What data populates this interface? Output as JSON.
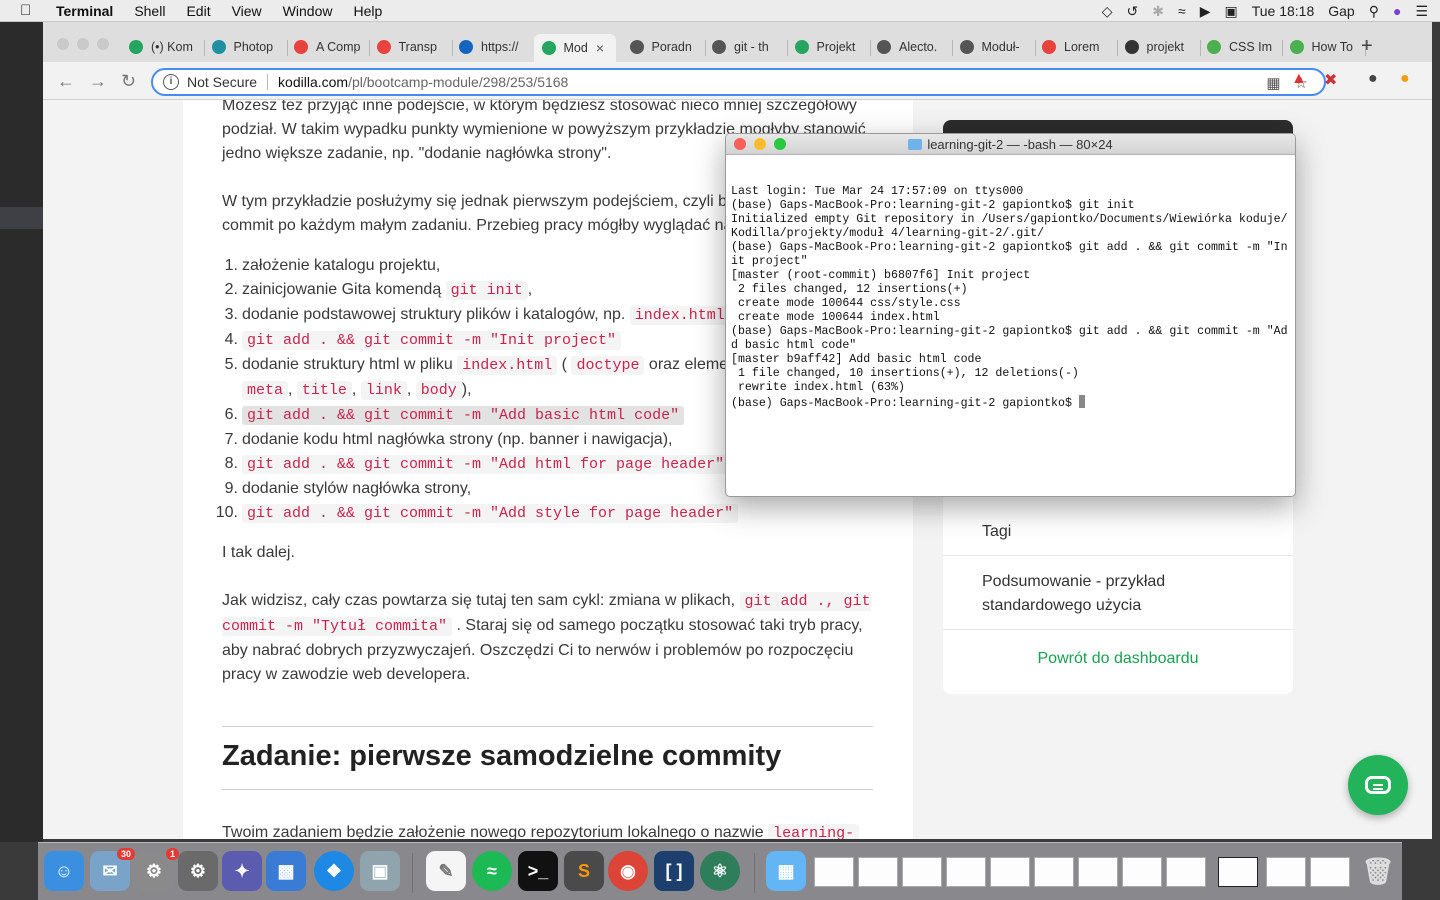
{
  "menubar": {
    "app": "Terminal",
    "items": [
      "Shell",
      "Edit",
      "View",
      "Window",
      "Help"
    ],
    "clock": "Tue 18:18",
    "user": "Gap"
  },
  "browser": {
    "tabs": [
      {
        "label": "(•) Kom",
        "color": "#25a55f"
      },
      {
        "label": "Photop",
        "color": "#1e90a0"
      },
      {
        "label": "A Comp",
        "color": "#e8433c"
      },
      {
        "label": "Transp",
        "color": "#e8433c"
      },
      {
        "label": "https://",
        "color": "#1565c0"
      },
      {
        "label": "Mod",
        "color": "#25a55f"
      },
      {
        "label": "Poradn",
        "color": "#555555"
      },
      {
        "label": "git - th",
        "color": "#555555"
      },
      {
        "label": "Projekt",
        "color": "#25a55f"
      },
      {
        "label": "Alecto.",
        "color": "#555555"
      },
      {
        "label": "Moduł-",
        "color": "#555555"
      },
      {
        "label": "Lorem",
        "color": "#e8433c"
      },
      {
        "label": "projekt",
        "color": "#333333"
      },
      {
        "label": "CSS Im",
        "color": "#4caf50"
      },
      {
        "label": "How To",
        "color": "#4caf50"
      }
    ],
    "url_security": "Not Secure",
    "url_host": "kodilla.com",
    "url_path": "/pl/bootcamp-module/298/253/5168"
  },
  "article": {
    "para1": "Możesz też przyjąć inne podejście, w którym będziesz stosować nieco mniej szczegółowy podział. W takim wypadku punkty wymienione w powyższym przykładzie mogłyby stanowić jedno większe zadanie, np. \"dodanie nagłówka strony\".",
    "para2": "W tym przykładzie posłużymy się jednak pierwszym podejściem, czyli będziemy robić commit po każdym małym zadaniu. Przebieg pracy mógłby wyglądać następująco:",
    "steps": {
      "s1": "założenie katalogu projektu,",
      "s2_text": "zainicjowanie Gita komendą",
      "s2_code": "git init",
      "s3_text": "dodanie podstawowej struktury plików i katalogów, np.",
      "s3_code": "index.html",
      "s4_code": "git add . && git commit -m \"Init project\"",
      "s5_text": "dodanie struktury html w pliku",
      "s5_code1": "index.html",
      "s5_code2": "doctype",
      "s5_tail": "oraz elementów",
      "s5_c3": "meta",
      "s5_c4": "title",
      "s5_c5": "link",
      "s5_c6": "body",
      "s6_code": "git add . && git commit -m \"Add basic html code\"",
      "s7": "dodanie kodu html nagłówka strony (np. banner i nawigacja),",
      "s8_code": "git add . && git commit -m \"Add html for page header\"",
      "s9": "dodanie stylów nagłówka strony,",
      "s10_code": "git add . && git commit -m \"Add style for page header\""
    },
    "tak_dalej": "I tak dalej.",
    "para3_a": "Jak widzisz, cały czas powtarza się tutaj ten sam cykl: zmiana w plikach,",
    "para3_code": "git add ., git commit -m \"Tytuł commita\"",
    "para3_b": ". Staraj się od samego początku stosować taki tryb pracy, aby nabrać dobrych przyzwyczajeń. Oszczędzi Ci to nerwów i problemów po rozpoczęciu pracy w zawodzie web developera.",
    "heading": "Zadanie: pierwsze samodzielne commity",
    "para4": "Twoim zadaniem będzie założenie nowego repozytorium lokalnego o nazwie",
    "para4_code": "learning-"
  },
  "sidebar": {
    "item_tagi": "Tagi",
    "item_summary": "Podsumowanie - przykład standardowego użycia",
    "back": "Powrót do dashboardu"
  },
  "terminal": {
    "title": "learning-git-2 — -bash — 80×24",
    "lines": [
      "Last login: Tue Mar 24 17:57:09 on ttys000",
      "(base) Gaps-MacBook-Pro:learning-git-2 gapiontko$ git init",
      "Initialized empty Git repository in /Users/gapiontko/Documents/Wiewiórka koduje/",
      "Kodilla/projekty/moduł 4/learning-git-2/.git/",
      "(base) Gaps-MacBook-Pro:learning-git-2 gapiontko$ git add . && git commit -m \"In",
      "it project\"",
      "[master (root-commit) b6807f6] Init project",
      " 2 files changed, 12 insertions(+)",
      " create mode 100644 css/style.css",
      " create mode 100644 index.html",
      "(base) Gaps-MacBook-Pro:learning-git-2 gapiontko$ git add . && git commit -m \"Ad",
      "d basic html code\"",
      "[master b9aff42] Add basic html code",
      " 1 file changed, 10 insertions(+), 12 deletions(-)",
      " rewrite index.html (63%)"
    ],
    "prompt": "(base) Gaps-MacBook-Pro:learning-git-2 gapiontko$ "
  },
  "dock": {
    "mail_badge": "30",
    "prefs_badge": "1"
  }
}
